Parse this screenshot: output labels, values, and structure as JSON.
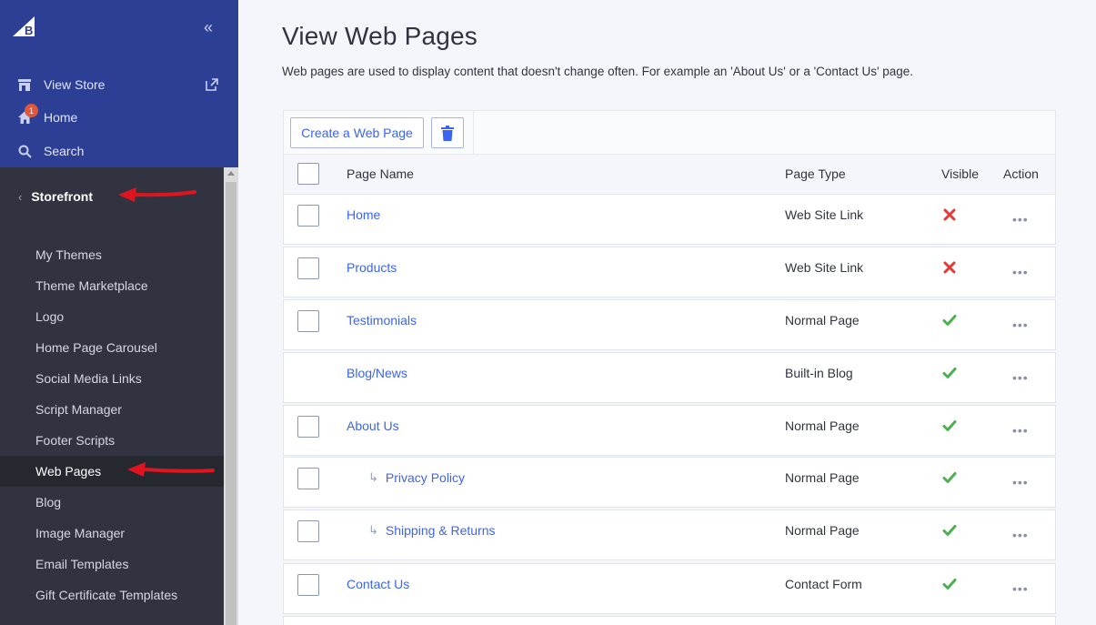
{
  "sidebar": {
    "top_links": {
      "view_store": "View Store",
      "home": "Home",
      "home_badge": "1",
      "search": "Search"
    },
    "section": "Storefront",
    "items": [
      {
        "label": "My Themes",
        "active": false
      },
      {
        "label": "Theme Marketplace",
        "active": false
      },
      {
        "label": "Logo",
        "active": false
      },
      {
        "label": "Home Page Carousel",
        "active": false
      },
      {
        "label": "Social Media Links",
        "active": false
      },
      {
        "label": "Script Manager",
        "active": false
      },
      {
        "label": "Footer Scripts",
        "active": false
      },
      {
        "label": "Web Pages",
        "active": true
      },
      {
        "label": "Blog",
        "active": false
      },
      {
        "label": "Image Manager",
        "active": false
      },
      {
        "label": "Email Templates",
        "active": false
      },
      {
        "label": "Gift Certificate Templates",
        "active": false
      }
    ]
  },
  "main": {
    "title": "View Web Pages",
    "description": "Web pages are used to display content that doesn't change often. For example an 'About Us' or a 'Contact Us' page.",
    "toolbar": {
      "create_label": "Create a Web Page"
    },
    "table": {
      "headers": {
        "page_name": "Page Name",
        "page_type": "Page Type",
        "visible": "Visible",
        "action": "Action"
      },
      "rows": [
        {
          "name": "Home",
          "type": "Web Site Link",
          "visible": false,
          "child": false,
          "checkbox": true
        },
        {
          "name": "Products",
          "type": "Web Site Link",
          "visible": false,
          "child": false,
          "checkbox": true
        },
        {
          "name": "Testimonials",
          "type": "Normal Page",
          "visible": true,
          "child": false,
          "checkbox": true
        },
        {
          "name": "Blog/News",
          "type": "Built-in Blog",
          "visible": true,
          "child": false,
          "checkbox": false
        },
        {
          "name": "About Us",
          "type": "Normal Page",
          "visible": true,
          "child": false,
          "checkbox": true
        },
        {
          "name": "Privacy Policy",
          "type": "Normal Page",
          "visible": true,
          "child": true,
          "checkbox": true
        },
        {
          "name": "Shipping & Returns",
          "type": "Normal Page",
          "visible": true,
          "child": true,
          "checkbox": true
        },
        {
          "name": "Contact Us",
          "type": "Contact Form",
          "visible": true,
          "child": false,
          "checkbox": true
        }
      ],
      "action_glyph": "•••"
    }
  },
  "colors": {
    "sidebar_top": "#2d3f94",
    "sidebar_bottom": "#313440",
    "link": "#3c64f4",
    "visible_yes": "#4caf50",
    "visible_no": "#e53935",
    "annotation_arrow": "#e0141e"
  }
}
